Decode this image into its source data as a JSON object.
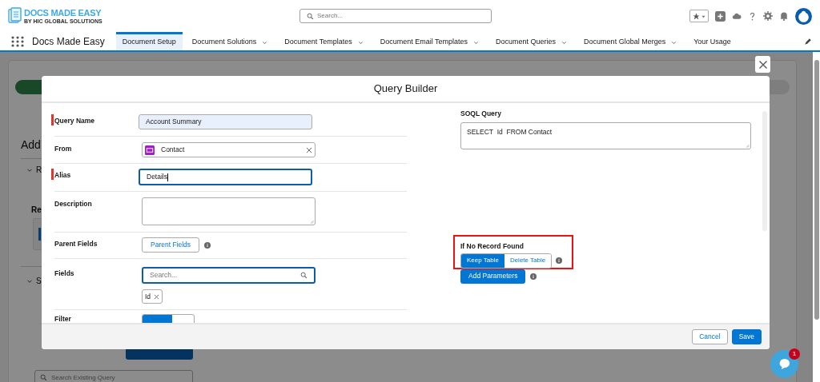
{
  "brand": {
    "name": "DOCS MADE EASY",
    "tagline": "BY HIC GLOBAL SOLUTIONS"
  },
  "global_search": {
    "placeholder": "Search..."
  },
  "app_name": "Docs Made Easy",
  "nav_tabs": [
    {
      "label": "Document Setup",
      "selected": true,
      "has_menu": false
    },
    {
      "label": "Document Solutions",
      "selected": false,
      "has_menu": true
    },
    {
      "label": "Document Templates",
      "selected": false,
      "has_menu": true
    },
    {
      "label": "Document Email Templates",
      "selected": false,
      "has_menu": true
    },
    {
      "label": "Document Queries",
      "selected": false,
      "has_menu": true
    },
    {
      "label": "Document Global Merges",
      "selected": false,
      "has_menu": true
    },
    {
      "label": "Your Usage",
      "selected": false,
      "has_menu": false
    }
  ],
  "background": {
    "heading": "Add",
    "sections": [
      {
        "title": "R"
      },
      {
        "title": "S"
      }
    ],
    "subheading": "Re",
    "search_placeholder": "Search Existing Query"
  },
  "modal": {
    "title": "Query Builder",
    "rows": [
      {
        "kind": "text",
        "label": "Query Name",
        "required": true,
        "value": "Account Summary",
        "highlighted": true,
        "focused": false
      },
      {
        "kind": "lookup",
        "label": "From",
        "required": false,
        "value": "Contact"
      },
      {
        "kind": "text",
        "label": "Alias",
        "required": true,
        "value": "Details",
        "highlighted": false,
        "focused": true
      },
      {
        "kind": "textarea",
        "label": "Description",
        "required": false
      },
      {
        "kind": "button",
        "label": "Parent Fields",
        "required": false,
        "button": "Parent Fields"
      },
      {
        "kind": "search",
        "label": "Fields",
        "required": false,
        "placeholder": "Search...",
        "focused": true,
        "pills": [
          "Id"
        ]
      },
      {
        "kind": "toggle",
        "label": "Filter",
        "required": false
      }
    ],
    "soql": {
      "label": "SOQL Query",
      "value": "SELECT  Id  FROM Contact"
    },
    "no_record": {
      "label": "If No Record Found",
      "highlighted": true,
      "options": [
        {
          "label": "Keep Table",
          "selected": true
        },
        {
          "label": "Delete Table",
          "selected": false
        }
      ]
    },
    "add_parameters": "Add Parameters",
    "footer_buttons": [
      {
        "label": "Cancel",
        "kind": "neutral"
      },
      {
        "label": "Save",
        "kind": "brand"
      }
    ]
  },
  "chat": {
    "badge": "1"
  }
}
